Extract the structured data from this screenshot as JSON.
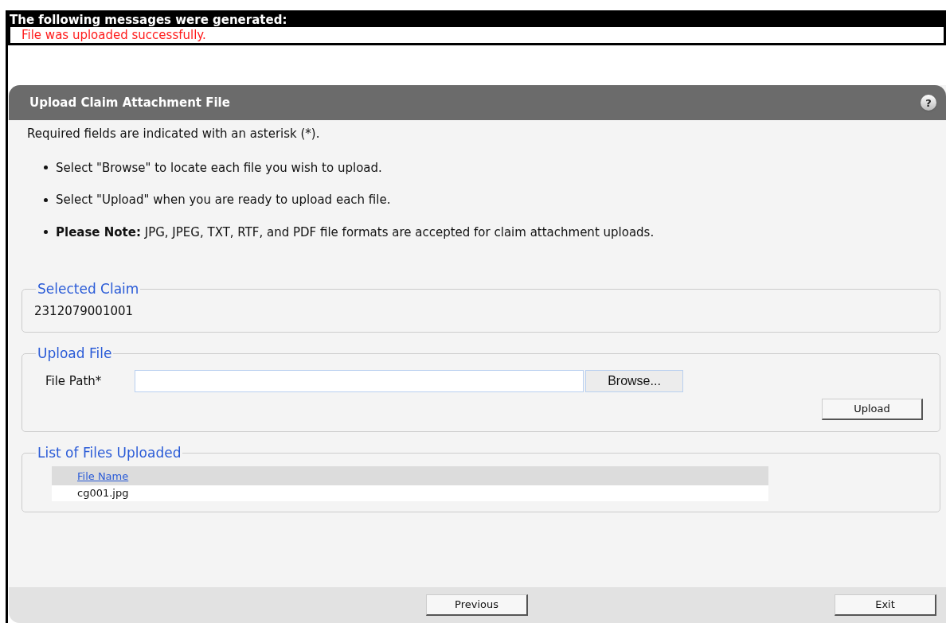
{
  "messages": {
    "heading": "The following messages were generated:",
    "items": [
      "File was uploaded successfully."
    ]
  },
  "panel": {
    "title": "Upload Claim Attachment File",
    "help": "?",
    "required_note": "Required fields are indicated with an asterisk (*).",
    "instructions": [
      "Select \"Browse\" to locate each file you wish to upload.",
      "Select \"Upload\" when you are ready to upload each file.",
      "**Please Note:** JPG, JPEG, TXT, RTF, and PDF file formats are accepted for claim attachment uploads."
    ],
    "selected_claim": {
      "legend": "Selected Claim",
      "value": "2312079001001"
    },
    "upload_file": {
      "legend": "Upload File",
      "label": "File Path*",
      "browse_button": "Browse...",
      "upload_button": "Upload"
    },
    "files": {
      "legend": "List of Files Uploaded",
      "columns": [
        "File Name"
      ],
      "rows": [
        [
          "cg001.jpg"
        ]
      ]
    },
    "buttons": [
      "Previous",
      "Exit"
    ]
  }
}
